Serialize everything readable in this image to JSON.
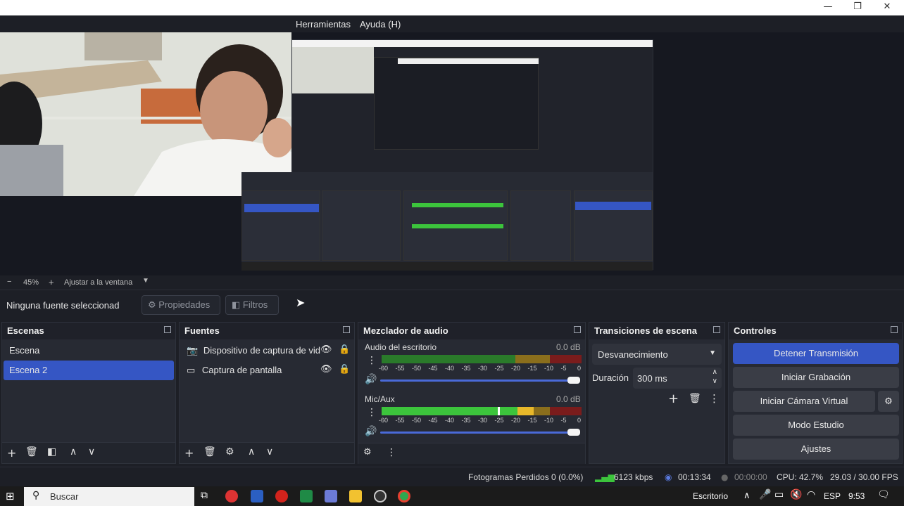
{
  "menu": {
    "items": [
      "Herramientas",
      "Ayuda (H)"
    ]
  },
  "zoom": {
    "minus": "−",
    "value": "45%",
    "plus": "+",
    "fit_label": "Ajustar a la ventana"
  },
  "source_toolbar": {
    "no_source": "Ninguna fuente seleccionad",
    "properties": "Propiedades",
    "filters": "Filtros"
  },
  "scenes": {
    "title": "Escenas",
    "items": [
      "Escena",
      "Escena 2"
    ],
    "selected_index": 1
  },
  "sources": {
    "title": "Fuentes",
    "items": [
      {
        "label": "Dispositivo de captura de vid",
        "icon": "camera-icon"
      },
      {
        "label": "Captura de pantalla",
        "icon": "monitor-icon"
      }
    ]
  },
  "mixer": {
    "title": "Mezclador de audio",
    "tracks": [
      {
        "name": "Audio del escritorio",
        "db": "0.0 dB",
        "level": 0.0
      },
      {
        "name": "Mic/Aux",
        "db": "0.0 dB",
        "level": 0.6
      }
    ],
    "ticks": [
      "-60",
      "-55",
      "-50",
      "-45",
      "-40",
      "-35",
      "-30",
      "-25",
      "-20",
      "-15",
      "-10",
      "-5",
      "0"
    ]
  },
  "transitions": {
    "title": "Transiciones de escena",
    "selected": "Desvanecimiento",
    "duration_label": "Duración",
    "duration_value": "300 ms"
  },
  "controls": {
    "title": "Controles",
    "buttons": [
      "Detener Transmisión",
      "Iniciar Grabación",
      "Iniciar Cámara Virtual",
      "Modo Estudio",
      "Ajustes"
    ]
  },
  "status": {
    "dropped": "Fotogramas Perdidos 0 (0.0%)",
    "bitrate": "6123 kbps",
    "live_time": "00:13:34",
    "rec_time": "00:00:00",
    "cpu": "CPU: 42.7%",
    "fps": "29.03 / 30.00 FPS"
  },
  "taskbar": {
    "search": "Buscar",
    "desktop": "Escritorio",
    "lang": "ESP",
    "time": "9:53"
  },
  "colors": {
    "accent": "#3556c4",
    "panel": "#272a33",
    "bg": "#1d1f26",
    "meter_green": "#3cc43c",
    "meter_yellow": "#d8b02a",
    "meter_red": "#c22a2a"
  }
}
